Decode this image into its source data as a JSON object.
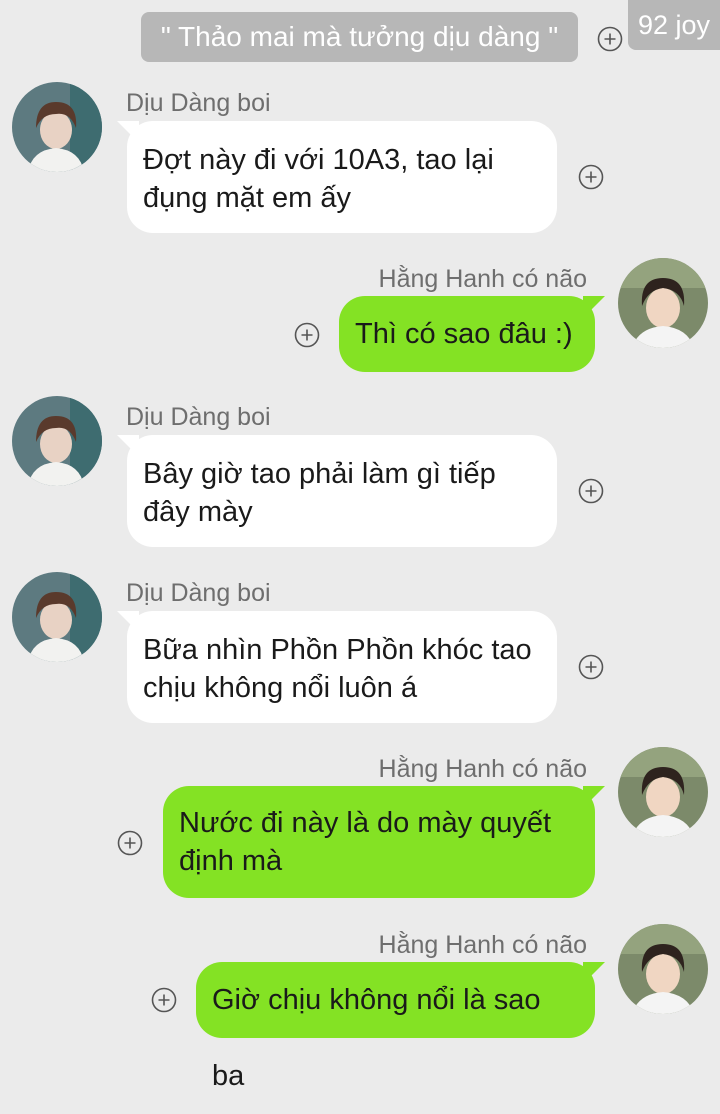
{
  "header": {
    "quote_text": "\" Thảo mai mà tưởng dịu dàng \"",
    "watermark": "92 joy"
  },
  "messages": [
    {
      "sender": "Dịu Dàng boi",
      "side": "left",
      "lines": [
        "Đợt này đi với 10A3, tao lại",
        "đụng mặt em ấy"
      ]
    },
    {
      "sender": "Hằng Hanh có não",
      "side": "right",
      "lines": [
        "Thì có sao đâu :)"
      ]
    },
    {
      "sender": "Dịu Dàng boi",
      "side": "left",
      "lines": [
        "Bây giờ tao phải làm gì tiếp",
        "đây mày"
      ]
    },
    {
      "sender": "Dịu Dàng boi",
      "side": "left",
      "lines": [
        "Bữa nhìn Phồn Phồn khóc tao",
        "chịu không nổi luôn á"
      ]
    },
    {
      "sender": "Hằng Hanh có não",
      "side": "right",
      "lines": [
        "Nước đi này là do mày quyết",
        "định mà"
      ]
    },
    {
      "sender": "Hằng Hanh có não",
      "side": "right",
      "lines": [
        "Giờ chịu không nổi là sao ba"
      ]
    }
  ],
  "icons": {
    "plus": "plus-circle-icon",
    "avatar_left": "avatar",
    "avatar_right": "avatar"
  },
  "colors": {
    "background": "#ebebeb",
    "left_bubble": "#ffffff",
    "right_bubble": "#84e224",
    "quote_bubble": "#b7b7b7",
    "name_text": "#6e6e6e"
  }
}
